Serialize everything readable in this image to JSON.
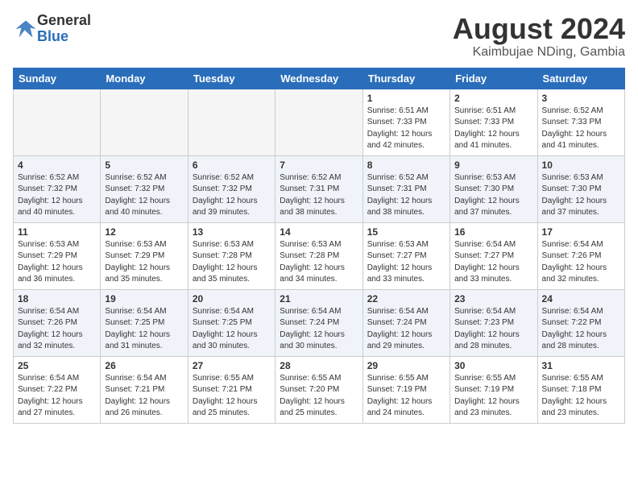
{
  "header": {
    "logo_line1": "General",
    "logo_line2": "Blue",
    "month_title": "August 2024",
    "location": "Kaimbujae NDing, Gambia"
  },
  "weekdays": [
    "Sunday",
    "Monday",
    "Tuesday",
    "Wednesday",
    "Thursday",
    "Friday",
    "Saturday"
  ],
  "weeks": [
    [
      {
        "day": "",
        "info": ""
      },
      {
        "day": "",
        "info": ""
      },
      {
        "day": "",
        "info": ""
      },
      {
        "day": "",
        "info": ""
      },
      {
        "day": "1",
        "info": "Sunrise: 6:51 AM\nSunset: 7:33 PM\nDaylight: 12 hours\nand 42 minutes."
      },
      {
        "day": "2",
        "info": "Sunrise: 6:51 AM\nSunset: 7:33 PM\nDaylight: 12 hours\nand 41 minutes."
      },
      {
        "day": "3",
        "info": "Sunrise: 6:52 AM\nSunset: 7:33 PM\nDaylight: 12 hours\nand 41 minutes."
      }
    ],
    [
      {
        "day": "4",
        "info": "Sunrise: 6:52 AM\nSunset: 7:32 PM\nDaylight: 12 hours\nand 40 minutes."
      },
      {
        "day": "5",
        "info": "Sunrise: 6:52 AM\nSunset: 7:32 PM\nDaylight: 12 hours\nand 40 minutes."
      },
      {
        "day": "6",
        "info": "Sunrise: 6:52 AM\nSunset: 7:32 PM\nDaylight: 12 hours\nand 39 minutes."
      },
      {
        "day": "7",
        "info": "Sunrise: 6:52 AM\nSunset: 7:31 PM\nDaylight: 12 hours\nand 38 minutes."
      },
      {
        "day": "8",
        "info": "Sunrise: 6:52 AM\nSunset: 7:31 PM\nDaylight: 12 hours\nand 38 minutes."
      },
      {
        "day": "9",
        "info": "Sunrise: 6:53 AM\nSunset: 7:30 PM\nDaylight: 12 hours\nand 37 minutes."
      },
      {
        "day": "10",
        "info": "Sunrise: 6:53 AM\nSunset: 7:30 PM\nDaylight: 12 hours\nand 37 minutes."
      }
    ],
    [
      {
        "day": "11",
        "info": "Sunrise: 6:53 AM\nSunset: 7:29 PM\nDaylight: 12 hours\nand 36 minutes."
      },
      {
        "day": "12",
        "info": "Sunrise: 6:53 AM\nSunset: 7:29 PM\nDaylight: 12 hours\nand 35 minutes."
      },
      {
        "day": "13",
        "info": "Sunrise: 6:53 AM\nSunset: 7:28 PM\nDaylight: 12 hours\nand 35 minutes."
      },
      {
        "day": "14",
        "info": "Sunrise: 6:53 AM\nSunset: 7:28 PM\nDaylight: 12 hours\nand 34 minutes."
      },
      {
        "day": "15",
        "info": "Sunrise: 6:53 AM\nSunset: 7:27 PM\nDaylight: 12 hours\nand 33 minutes."
      },
      {
        "day": "16",
        "info": "Sunrise: 6:54 AM\nSunset: 7:27 PM\nDaylight: 12 hours\nand 33 minutes."
      },
      {
        "day": "17",
        "info": "Sunrise: 6:54 AM\nSunset: 7:26 PM\nDaylight: 12 hours\nand 32 minutes."
      }
    ],
    [
      {
        "day": "18",
        "info": "Sunrise: 6:54 AM\nSunset: 7:26 PM\nDaylight: 12 hours\nand 32 minutes."
      },
      {
        "day": "19",
        "info": "Sunrise: 6:54 AM\nSunset: 7:25 PM\nDaylight: 12 hours\nand 31 minutes."
      },
      {
        "day": "20",
        "info": "Sunrise: 6:54 AM\nSunset: 7:25 PM\nDaylight: 12 hours\nand 30 minutes."
      },
      {
        "day": "21",
        "info": "Sunrise: 6:54 AM\nSunset: 7:24 PM\nDaylight: 12 hours\nand 30 minutes."
      },
      {
        "day": "22",
        "info": "Sunrise: 6:54 AM\nSunset: 7:24 PM\nDaylight: 12 hours\nand 29 minutes."
      },
      {
        "day": "23",
        "info": "Sunrise: 6:54 AM\nSunset: 7:23 PM\nDaylight: 12 hours\nand 28 minutes."
      },
      {
        "day": "24",
        "info": "Sunrise: 6:54 AM\nSunset: 7:22 PM\nDaylight: 12 hours\nand 28 minutes."
      }
    ],
    [
      {
        "day": "25",
        "info": "Sunrise: 6:54 AM\nSunset: 7:22 PM\nDaylight: 12 hours\nand 27 minutes."
      },
      {
        "day": "26",
        "info": "Sunrise: 6:54 AM\nSunset: 7:21 PM\nDaylight: 12 hours\nand 26 minutes."
      },
      {
        "day": "27",
        "info": "Sunrise: 6:55 AM\nSunset: 7:21 PM\nDaylight: 12 hours\nand 25 minutes."
      },
      {
        "day": "28",
        "info": "Sunrise: 6:55 AM\nSunset: 7:20 PM\nDaylight: 12 hours\nand 25 minutes."
      },
      {
        "day": "29",
        "info": "Sunrise: 6:55 AM\nSunset: 7:19 PM\nDaylight: 12 hours\nand 24 minutes."
      },
      {
        "day": "30",
        "info": "Sunrise: 6:55 AM\nSunset: 7:19 PM\nDaylight: 12 hours\nand 23 minutes."
      },
      {
        "day": "31",
        "info": "Sunrise: 6:55 AM\nSunset: 7:18 PM\nDaylight: 12 hours\nand 23 minutes."
      }
    ]
  ]
}
